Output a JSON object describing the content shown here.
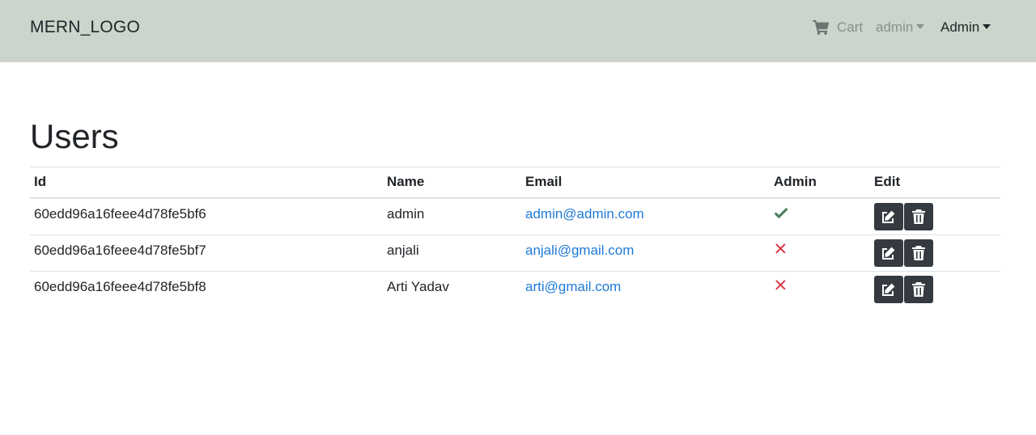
{
  "navbar": {
    "brand": "MERN_LOGO",
    "cart_label": "Cart",
    "user_menu_label": "admin",
    "admin_menu_label": "Admin",
    "background": "#cbd5cb"
  },
  "page": {
    "title": "Users"
  },
  "table": {
    "headers": {
      "id": "Id",
      "name": "Name",
      "email": "Email",
      "admin": "Admin",
      "edit": "Edit"
    },
    "rows": [
      {
        "id": "60edd96a16feee4d78fe5bf6",
        "name": "admin",
        "email": "admin@admin.com",
        "is_admin": true
      },
      {
        "id": "60edd96a16feee4d78fe5bf7",
        "name": "anjali",
        "email": "anjali@gmail.com",
        "is_admin": false
      },
      {
        "id": "60edd96a16feee4d78fe5bf8",
        "name": "Arti Yadav",
        "email": "arti@gmail.com",
        "is_admin": false
      }
    ]
  },
  "icons": {
    "cart": "shopping-cart-icon",
    "admin_true": "check-icon",
    "admin_false": "times-icon",
    "edit": "edit-icon",
    "delete": "trash-icon"
  },
  "colors": {
    "check": "#4a7c59",
    "cross": "#dc3545",
    "link": "#1f7ad8",
    "button": "#343a40"
  }
}
